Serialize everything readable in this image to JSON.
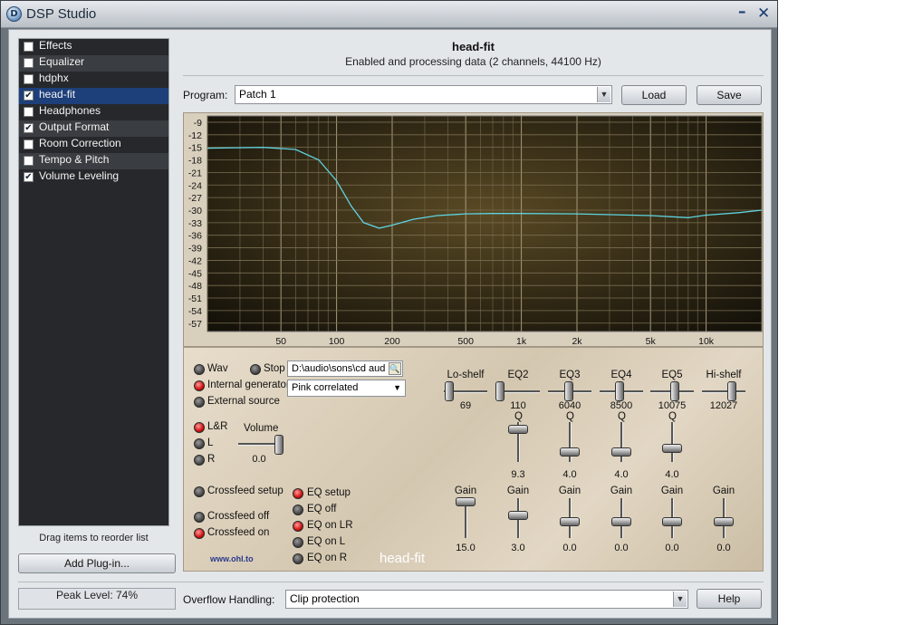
{
  "window": {
    "title": "DSP Studio",
    "minimize": "–",
    "close": "✕",
    "app_icon": "D"
  },
  "sidebar": {
    "items": [
      {
        "label": "Effects",
        "checked": false,
        "selected": false
      },
      {
        "label": "Equalizer",
        "checked": false,
        "selected": false
      },
      {
        "label": "hdphx",
        "checked": false,
        "selected": false
      },
      {
        "label": "head-fit",
        "checked": true,
        "selected": true
      },
      {
        "label": "Headphones",
        "checked": false,
        "selected": false
      },
      {
        "label": "Output Format",
        "checked": true,
        "selected": false
      },
      {
        "label": "Room Correction",
        "checked": false,
        "selected": false
      },
      {
        "label": "Tempo & Pitch",
        "checked": false,
        "selected": false
      },
      {
        "label": "Volume Leveling",
        "checked": true,
        "selected": false
      }
    ],
    "drag_hint": "Drag items to reorder list",
    "add_plugin": "Add Plug-in...",
    "check": "✔"
  },
  "header": {
    "title": "head-fit",
    "subtitle": "Enabled and processing data (2 channels, 44100 Hz)"
  },
  "program": {
    "label": "Program:",
    "value": "Patch   1",
    "load": "Load",
    "save": "Save",
    "arrow": "▼"
  },
  "chart_data": {
    "type": "line",
    "y_ticks": [
      "-9",
      "-12",
      "-15",
      "-18",
      "-21",
      "-24",
      "-27",
      "-30",
      "-33",
      "-36",
      "-39",
      "-42",
      "-45",
      "-48",
      "-51",
      "-54",
      "-57"
    ],
    "x_ticks": [
      "50",
      "100",
      "200",
      "500",
      "1k",
      "2k",
      "5k",
      "10k"
    ],
    "x_tick_values": [
      50,
      100,
      200,
      500,
      1000,
      2000,
      5000,
      10000
    ],
    "xlim": [
      20,
      20000
    ],
    "ylim": [
      -59,
      -7.5
    ],
    "x_scale": "log",
    "grid": true,
    "series": [
      {
        "x": [
          20,
          40,
          60,
          80,
          100,
          120,
          140,
          170,
          200,
          260,
          350,
          500,
          700,
          1000,
          2000,
          5000,
          8000,
          10000,
          15000,
          20000
        ],
        "y": [
          -15.2,
          -15,
          -15.5,
          -18,
          -23,
          -29,
          -33,
          -34.3,
          -33.6,
          -32.2,
          -31.3,
          -30.9,
          -30.8,
          -30.8,
          -30.9,
          -31.3,
          -31.8,
          -31.2,
          -30.6,
          -30
        ]
      }
    ]
  },
  "controls": {
    "wav": "Wav",
    "stop": "Stop",
    "file_path": "D:\\audio\\sons\\cd aud",
    "internal_gen": "Internal generator",
    "generator_value": "Pink correlated",
    "external": "External source",
    "lr": "L&R",
    "l": "L",
    "r": "R",
    "volume_label": "Volume",
    "volume_value": "0.0",
    "crossfeed_setup": "Crossfeed setup",
    "crossfeed_off": "Crossfeed off",
    "crossfeed_on": "Crossfeed on",
    "eq_setup": "EQ setup",
    "eq_off": "EQ off",
    "eq_on_lr": "EQ on LR",
    "eq_on_l": "EQ on L",
    "eq_on_r": "EQ on R",
    "url": "www.ohl.to",
    "watermark": "head-fit",
    "bands": [
      {
        "name": "Lo-shelf",
        "freq": "69",
        "q_label": "",
        "q": "",
        "gain_label": "Gain",
        "gain": "15.0"
      },
      {
        "name": "EQ2",
        "freq": "110",
        "q_label": "Q",
        "q": "9.3",
        "gain_label": "Gain",
        "gain": "3.0"
      },
      {
        "name": "EQ3",
        "freq": "6040",
        "q_label": "Q",
        "q": "4.0",
        "gain_label": "Gain",
        "gain": "0.0"
      },
      {
        "name": "EQ4",
        "freq": "8500",
        "q_label": "Q",
        "q": "4.0",
        "gain_label": "Gain",
        "gain": "0.0"
      },
      {
        "name": "EQ5",
        "freq": "10075",
        "q_label": "Q",
        "q": "4.0",
        "gain_label": "Gain",
        "gain": "0.0"
      },
      {
        "name": "Hi-shelf",
        "freq": "12027",
        "q_label": "",
        "q": "",
        "gain_label": "Gain",
        "gain": "0.0"
      }
    ]
  },
  "footer": {
    "peak": "Peak Level: 74%",
    "overflow_label": "Overflow Handling:",
    "overflow_value": "Clip protection",
    "help": "Help"
  }
}
